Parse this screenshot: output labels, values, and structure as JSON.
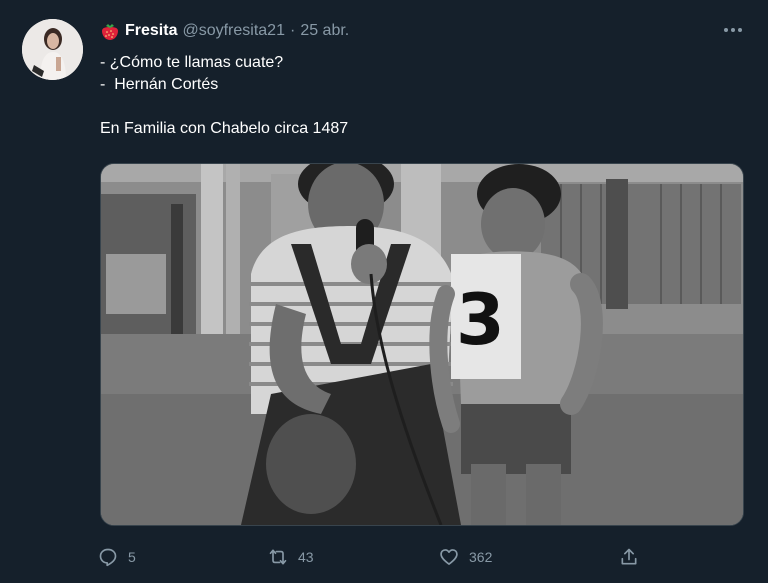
{
  "tweet": {
    "author": {
      "name": "Fresita",
      "handle": "@soyfresita21",
      "emoji_icon": "strawberry-icon"
    },
    "separator": "·",
    "date": "25 abr.",
    "lines": [
      "- ¿Cómo te llamas cuate?",
      "-  Hernán Cortés",
      "",
      "En Familia con Chabelo circa 1487"
    ],
    "media": {
      "bib_number": "3"
    },
    "actions": {
      "replies": "5",
      "retweets": "43",
      "likes": "362"
    }
  },
  "colors": {
    "background": "#15202b",
    "secondary_text": "#8899a6",
    "border": "#38444d"
  }
}
